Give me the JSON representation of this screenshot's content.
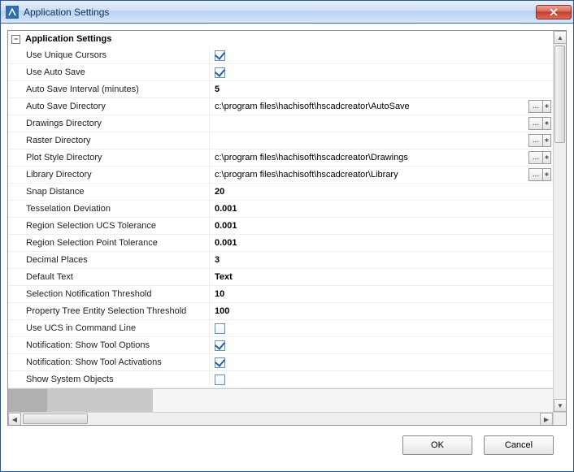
{
  "window": {
    "title": "Application Settings"
  },
  "group": {
    "title": "Application Settings"
  },
  "rows": {
    "useUniqueCursors": {
      "label": "Use Unique Cursors",
      "checked": true
    },
    "useAutoSave": {
      "label": "Use Auto Save",
      "checked": true
    },
    "autoSaveInterval": {
      "label": "Auto Save Interval (minutes)",
      "value": "5"
    },
    "autoSaveDir": {
      "label": "Auto Save Directory",
      "value": "c:\\program files\\hachisoft\\hscadcreator\\AutoSave"
    },
    "drawingsDir": {
      "label": "Drawings Directory",
      "value": ""
    },
    "rasterDir": {
      "label": "Raster Directory",
      "value": ""
    },
    "plotStyleDir": {
      "label": "Plot Style Directory",
      "value": "c:\\program files\\hachisoft\\hscadcreator\\Drawings"
    },
    "libraryDir": {
      "label": "Library Directory",
      "value": "c:\\program files\\hachisoft\\hscadcreator\\Library"
    },
    "snapDistance": {
      "label": "Snap Distance",
      "value": "20"
    },
    "tessDeviation": {
      "label": "Tesselation Deviation",
      "value": "0.001"
    },
    "regionUcsTol": {
      "label": "Region Selection UCS Tolerance",
      "value": "0.001"
    },
    "regionPtTol": {
      "label": "Region Selection Point Tolerance",
      "value": "0.001"
    },
    "decimalPlaces": {
      "label": "Decimal Places",
      "value": "3"
    },
    "defaultText": {
      "label": "Default Text",
      "value": "Text"
    },
    "selNotifThreshold": {
      "label": "Selection Notification Threshold",
      "value": "10"
    },
    "propTreeThreshold": {
      "label": "Property Tree Entity Selection Threshold",
      "value": "100"
    },
    "useUcsCmdLine": {
      "label": "Use UCS in Command Line",
      "checked": false
    },
    "notifToolOptions": {
      "label": "Notification: Show Tool Options",
      "checked": true
    },
    "notifToolActiv": {
      "label": "Notification: Show Tool Activations",
      "checked": true
    },
    "showSysObjects": {
      "label": "Show System Objects",
      "checked": false
    }
  },
  "buttons": {
    "ok": "OK",
    "cancel": "Cancel"
  }
}
